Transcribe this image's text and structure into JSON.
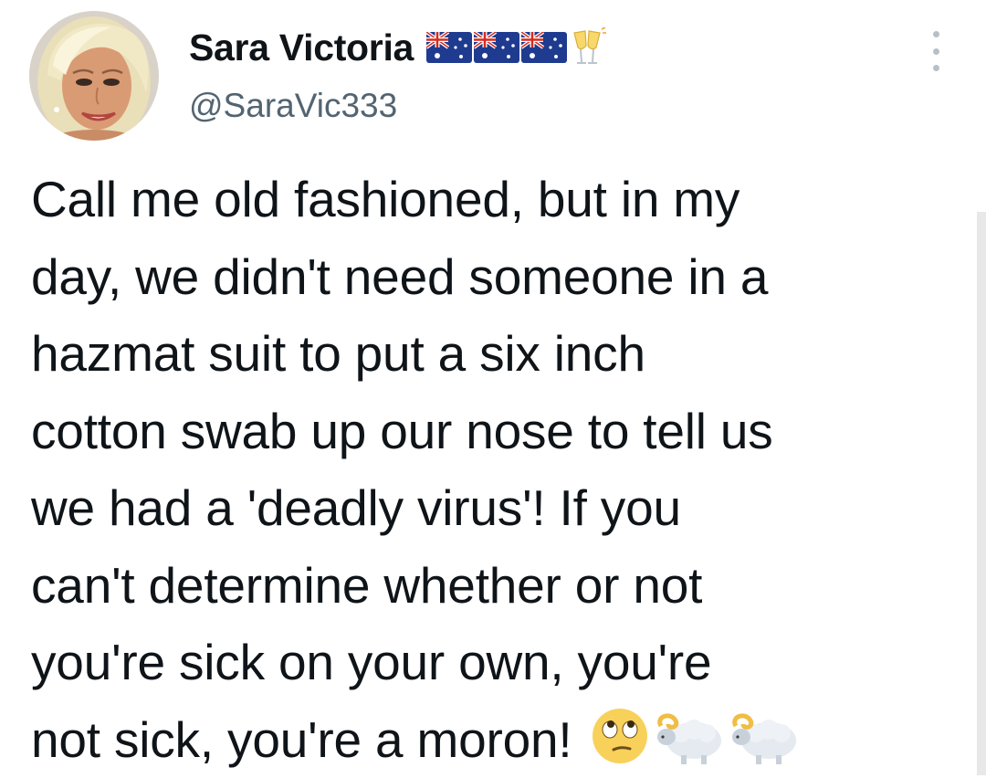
{
  "user": {
    "display_name": "Sara Victoria",
    "handle": "@SaraVic333",
    "name_emojis": [
      "australia-flag-icon",
      "australia-flag-icon",
      "australia-flag-icon",
      "clinking-glasses-icon"
    ],
    "avatar": "profile-photo"
  },
  "tweet": {
    "lines": [
      "Call me old fashioned, but in my",
      "day, we didn't need someone in a",
      "hazmat suit to put a six inch",
      "cotton swab up our nose to tell us",
      "we had a 'deadly virus'! If you",
      "can't determine whether or not",
      "you're sick on your own, you're",
      "not sick, you're a moron!"
    ],
    "trailing_emojis": [
      "face-with-rolling-eyes-icon",
      "ram-icon",
      "ram-icon"
    ]
  },
  "colors": {
    "text": "#0f1419",
    "secondary": "#536471",
    "background": "#ffffff"
  }
}
